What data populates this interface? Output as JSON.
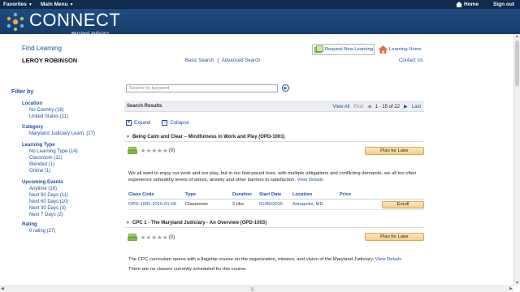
{
  "topbar": {
    "favorites": "Favorites",
    "main_menu": "Main Menu",
    "home": "Home",
    "sign_out": "Sign out"
  },
  "brand": {
    "name": "CONNECT",
    "sub": "Maryland Judiciary"
  },
  "header": {
    "title": "Find Learning",
    "user": "LEROY ROBINSON",
    "basic_search": "Basic Search",
    "separator": "|",
    "advanced_search": "Advanced Search",
    "request_new": "Request New Learning",
    "learning_home": "Learning Home",
    "contact_us": "Contact Us"
  },
  "filters": {
    "heading": "Filter by",
    "location": {
      "title": "Location",
      "items": [
        "No Country (16)",
        "United States (11)"
      ]
    },
    "category": {
      "title": "Category",
      "items": [
        "Maryland Judiciary Learn. (27)"
      ]
    },
    "learning_type": {
      "title": "Learning Type",
      "items": [
        "No Learning Type (14)",
        "Classroom (11)",
        "Blended (1)",
        "Online (1)"
      ]
    },
    "upcoming": {
      "title": "Upcoming Events",
      "items": [
        "Anytime (16)",
        "Next 90 Days (11)",
        "Next 60 Days (10)",
        "Next 30 Days (3)",
        "Next 7 Days (2)"
      ]
    },
    "rating": {
      "title": "Rating",
      "items": [
        "0 rating (27)"
      ]
    }
  },
  "search": {
    "placeholder": "Search by keyword"
  },
  "results": {
    "title": "Search Results",
    "view_all": "View All",
    "first": "First",
    "prev": "◀",
    "range": "1 - 15 of 22",
    "next": "▶",
    "last": "Last"
  },
  "controls": {
    "expand": "Expand",
    "collapse": "Collapse"
  },
  "courses": [
    {
      "title": "Being Calm and Clear – Mindfulness in Work and Play (OPD-1001)",
      "rating_count": "(0)",
      "plan": "Plan for Later",
      "description": "We all want to enjoy our work and our play, but in our fast-paced lives, with multiple obligations and conflicting demands, we all too often experience unhealthy levels of stress, anxiety and other barriers to satisfaction.",
      "view_details": "View Details",
      "session_headers": [
        "Class Code",
        "Type",
        "Duration",
        "Start Date",
        "Location",
        "Price"
      ],
      "session": {
        "code": "OPD-1001-2016-01-06",
        "type": "Classroom",
        "duration": "2 Hrs",
        "start": "01/06/2016",
        "location": "Annapolis, MD",
        "price": "",
        "action": "Enroll"
      }
    },
    {
      "title": "CPC 1 - The Maryland Judiciary - An Overview (OPD-1003)",
      "rating_count": "(0)",
      "plan": "Plan for Later",
      "description": "The CPC curriculum opens with a flagship course on the organization, mission, and vision of the Maryland Judiciary.",
      "view_details": "View Details",
      "note": "There are no classes currently scheduled for this course."
    }
  ],
  "colors": {
    "topbar": "#0f2a4a",
    "banner": "#1f4c80",
    "link": "#1f4e9c",
    "button": "#f6cf88"
  }
}
